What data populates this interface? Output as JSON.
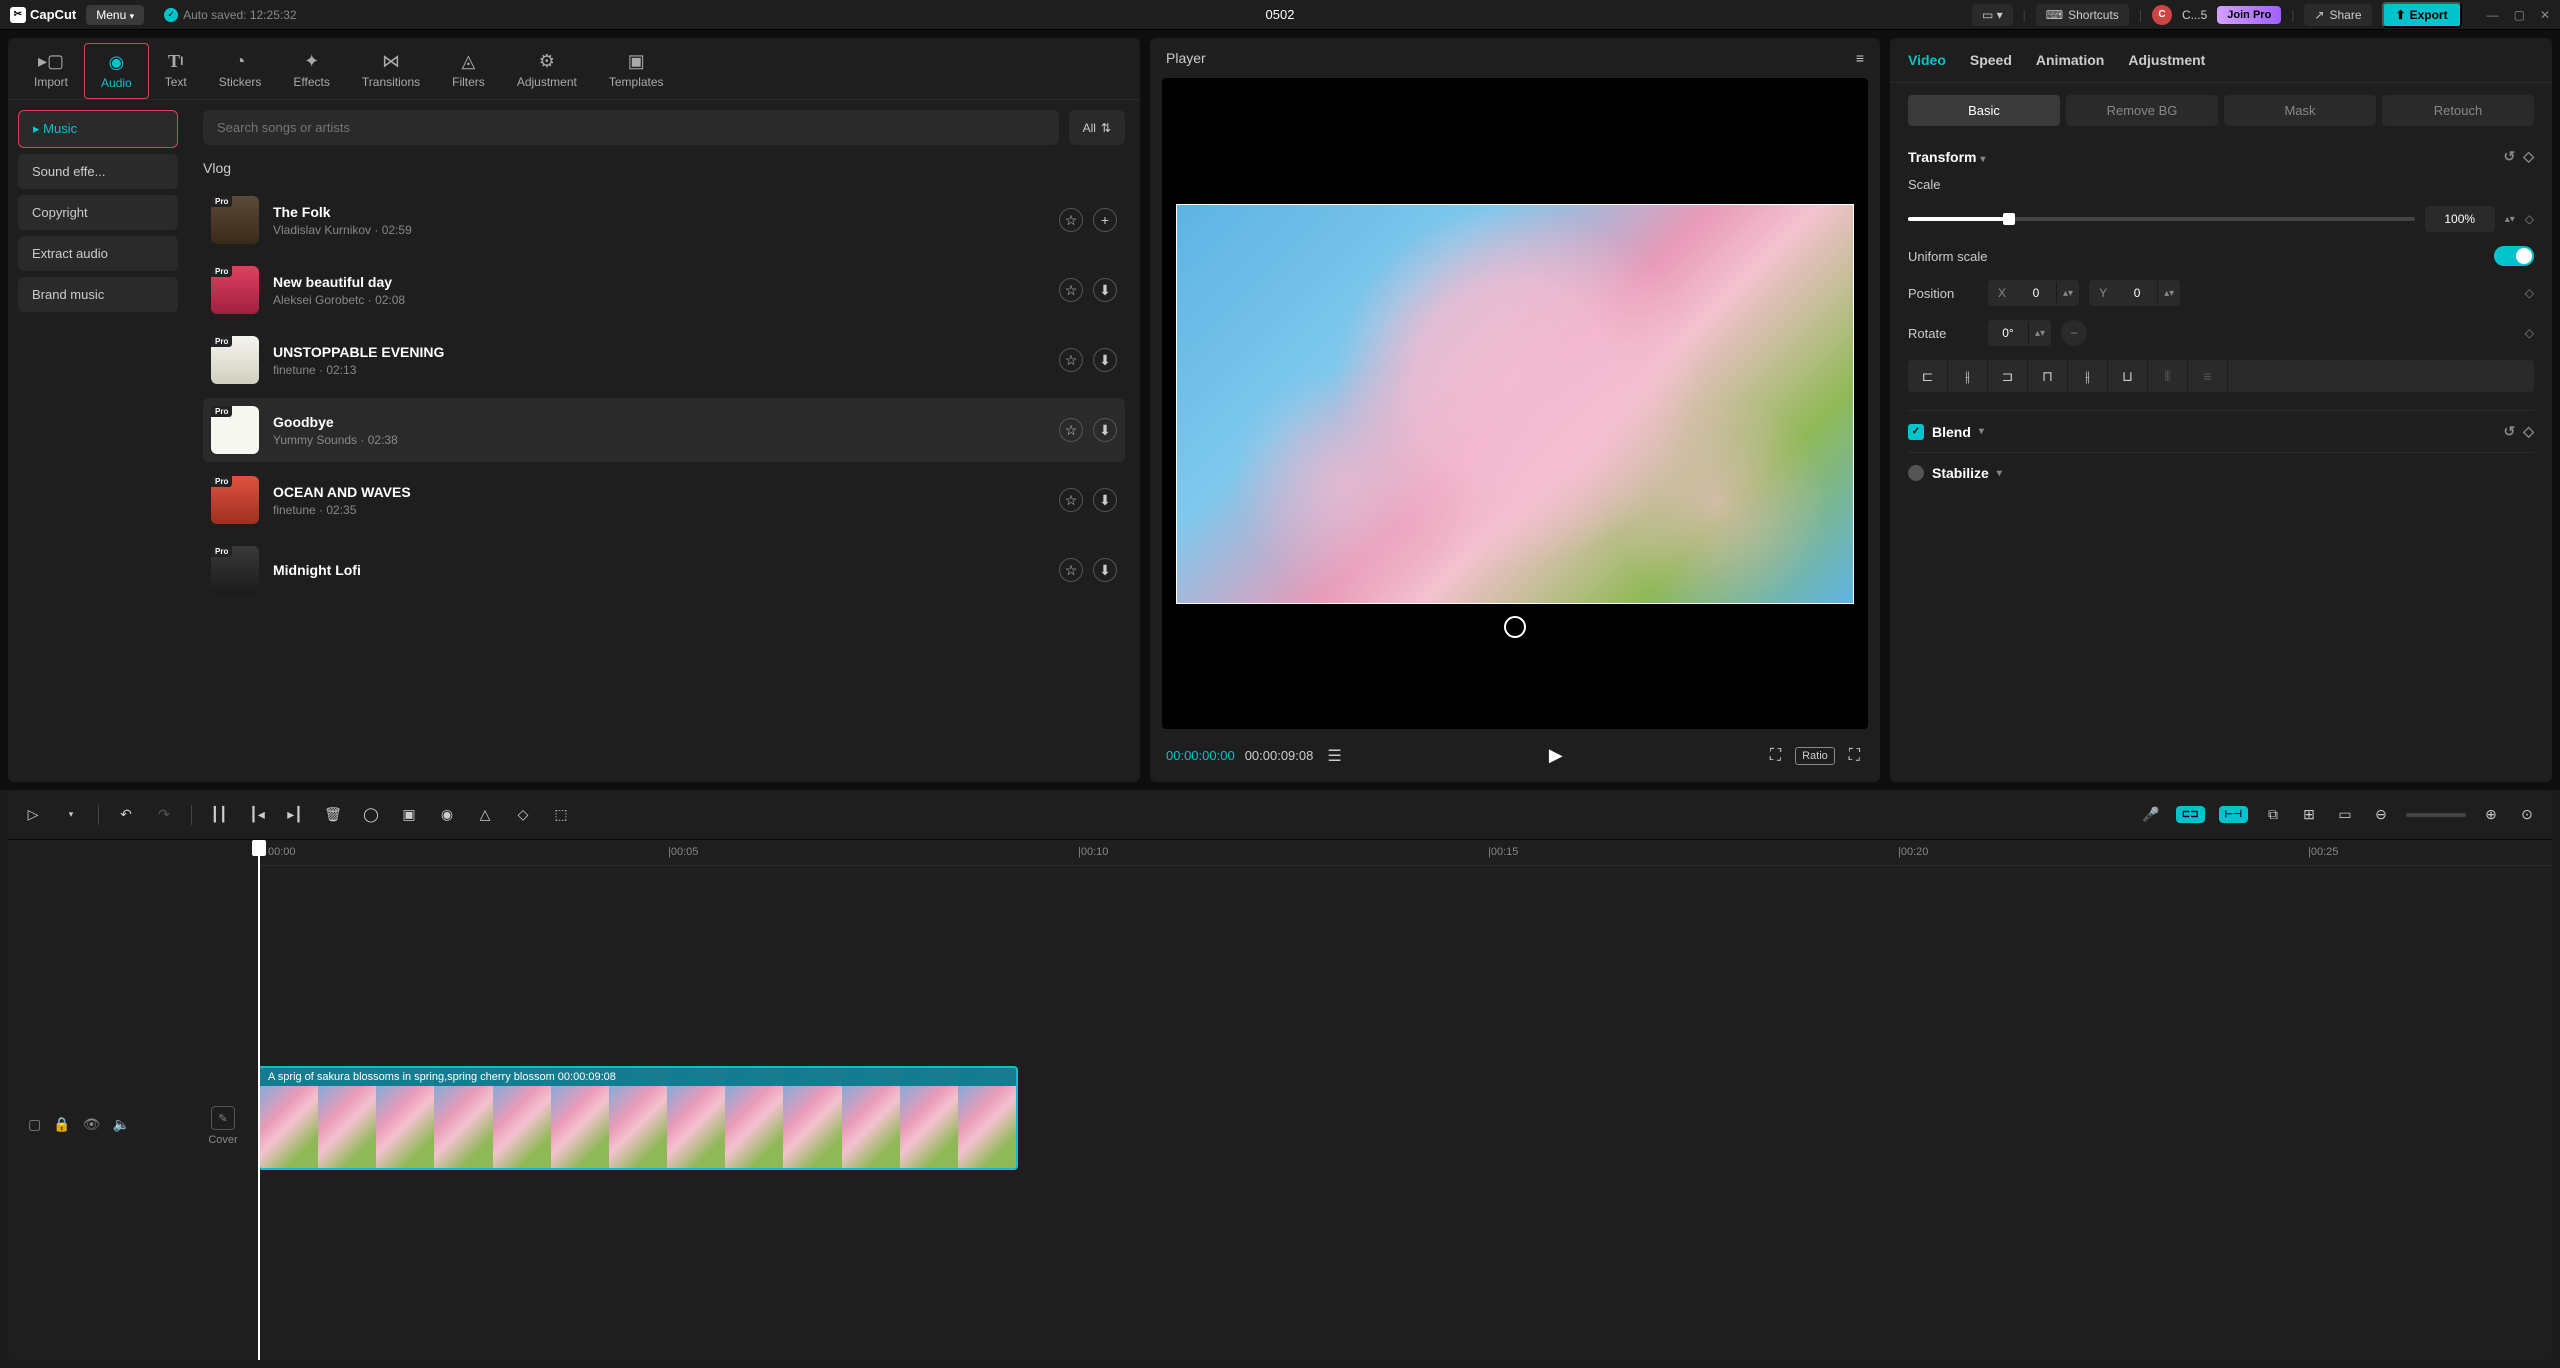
{
  "titlebar": {
    "app": "CapCut",
    "menu": "Menu",
    "autosave": "Auto saved: 12:25:32",
    "project": "0502",
    "shortcuts": "Shortcuts",
    "user": "C",
    "user_label": "C...5",
    "joinpro": "Join Pro",
    "share": "Share",
    "export": "Export"
  },
  "top_tabs": [
    {
      "label": "Import"
    },
    {
      "label": "Audio"
    },
    {
      "label": "Text"
    },
    {
      "label": "Stickers"
    },
    {
      "label": "Effects"
    },
    {
      "label": "Transitions"
    },
    {
      "label": "Filters"
    },
    {
      "label": "Adjustment"
    },
    {
      "label": "Templates"
    }
  ],
  "side_cats": [
    {
      "label": "Music"
    },
    {
      "label": "Sound effe..."
    },
    {
      "label": "Copyright"
    },
    {
      "label": "Extract audio"
    },
    {
      "label": "Brand music"
    }
  ],
  "search_placeholder": "Search songs or artists",
  "filter_all": "All",
  "section": "Vlog",
  "tracks": [
    {
      "title": "The Folk",
      "artist": "Vladislav Kurnikov",
      "dur": "02:59"
    },
    {
      "title": "New beautiful day",
      "artist": "Aleksei Gorobetc",
      "dur": "02:08"
    },
    {
      "title": "UNSTOPPABLE EVENING",
      "artist": "finetune",
      "dur": "02:13"
    },
    {
      "title": "Goodbye",
      "artist": "Yummy Sounds",
      "dur": "02:38"
    },
    {
      "title": "OCEAN AND WAVES",
      "artist": "finetune",
      "dur": "02:35"
    },
    {
      "title": "Midnight Lofi",
      "artist": "",
      "dur": ""
    }
  ],
  "player": {
    "title": "Player",
    "current": "00:00:00:00",
    "total": "00:00:09:08",
    "ratio": "Ratio"
  },
  "inspector": {
    "tabs": [
      "Video",
      "Speed",
      "Animation",
      "Adjustment"
    ],
    "subtabs": [
      "Basic",
      "Remove BG",
      "Mask",
      "Retouch"
    ],
    "transform": "Transform",
    "scale": "Scale",
    "scale_val": "100%",
    "uniform": "Uniform scale",
    "position": "Position",
    "pos_x_label": "X",
    "pos_x": "0",
    "pos_y_label": "Y",
    "pos_y": "0",
    "rotate": "Rotate",
    "rotate_val": "0°",
    "blend": "Blend",
    "stabilize": "Stabilize"
  },
  "ruler": [
    "00:00",
    "|00:05",
    "|00:10",
    "|00:15",
    "|00:20",
    "|00:25"
  ],
  "clip": {
    "label": "A sprig of sakura blossoms in spring,spring cherry blossom   00:00:09:08"
  },
  "cover": "Cover"
}
